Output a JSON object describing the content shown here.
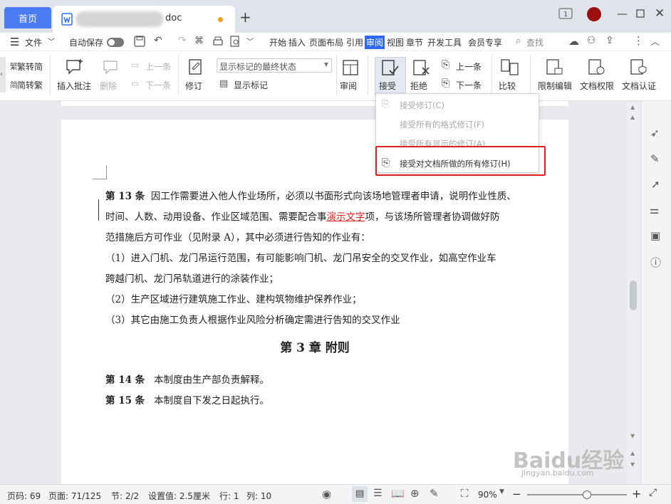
{
  "tabs": {
    "home": "首页",
    "doc_name": "doc"
  },
  "window": {
    "restore_label": "1"
  },
  "menu": {
    "file": "文件",
    "autosave": "自动保存",
    "items": [
      "开始",
      "插入",
      "页面布局",
      "引用",
      "审阅",
      "视图",
      "章节",
      "开发工具",
      "会员专享"
    ],
    "active": "审阅",
    "search": "查找"
  },
  "ribbon": {
    "trad2simp": "繁转简",
    "simp2trad": "简转繁",
    "insert_comment": "插入批注",
    "delete": "删除",
    "prev_comment": "上一条",
    "next_comment": "下一条",
    "revise": "修订",
    "markup_select": "显示标记的最终状态",
    "show_markup": "显示标记",
    "review": "审阅",
    "accept": "接受",
    "reject": "拒绝",
    "prev_change": "上一条",
    "next_change": "下一条",
    "compare": "比较",
    "restrict_edit": "限制编辑",
    "doc_permission": "文档权限",
    "doc_cert": "文档认证"
  },
  "dropdown": {
    "items": [
      "接受修订(C)",
      "接受所有的格式修订(F)",
      "接受所有显示的修订(A)",
      "接受对文档所做的所有修订(H)"
    ]
  },
  "document": {
    "art13_label": "第 13 条",
    "art13_line1": "因工作需要进入他人作业场所，必须以书面形式向该场地管理者申请，说明作业性质、",
    "art13_line2_a": "时间、人数、动用设备、作业区域范围、需要配合事",
    "art13_line2_ins": "演示文字",
    "art13_line2_b": "项，与该场所管理者协调做好防",
    "art13_line3": "范措施后方可作业（见附录 A），其中必须进行告知的作业有：",
    "item1_line1": "（1）进入门机、龙门吊运行范围，有可能影响门机、龙门吊安全的交叉作业，如高空作业车",
    "item1_line2": "跨越门机、龙门吊轨道进行的涂装作业；",
    "item2": "（2）生产区域进行建筑施工作业、建构筑物维护保养作业；",
    "item3": "（3）其它由施工负责人根据作业风险分析确定需进行告知的交叉作业",
    "chapter": "第 3 章  附则",
    "art14_label": "第 14 条",
    "art14_text": "本制度由生产部负责解释。",
    "art15_label": "第 15 条",
    "art15_text": "本制度自下发之日起执行。"
  },
  "status": {
    "page": "页码: 69",
    "pages": "页面: 71/125",
    "section": "节: 2/2",
    "setting": "设置值: 2.5厘米",
    "row": "行: 1",
    "col": "列: 10",
    "zoom": "90%",
    "zoom_level": 0.6
  },
  "watermark": {
    "text": "Baidu经验",
    "url": "jingyan.baidu.com"
  },
  "colors": {
    "accent": "#2f6bf2",
    "highlight": "#e02020",
    "insert": "#e02020"
  }
}
